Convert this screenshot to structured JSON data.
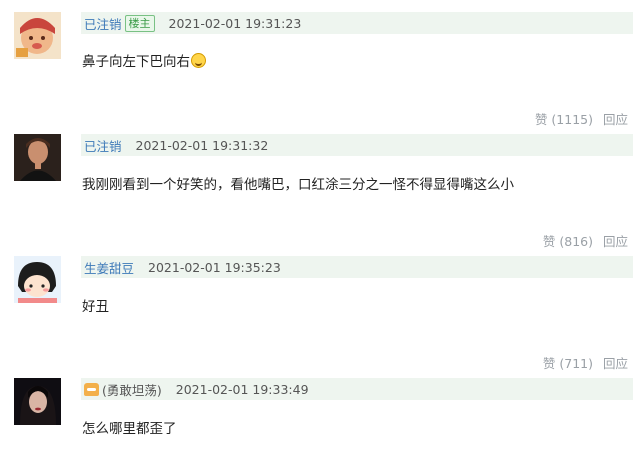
{
  "comments": [
    {
      "user": "已注销",
      "badge": "楼主",
      "time": "2021-02-01 19:31:23",
      "text": "鼻子向左下巴向右",
      "emoji_icon": "grin-emoji-icon",
      "like_label": "赞 (1115)",
      "reply_label": "回应"
    },
    {
      "user": "已注销",
      "time": "2021-02-01 19:31:32",
      "text": "我刚刚看到一个好笑的，看他嘴巴，口红涂三分之一怪不得显得嘴这么小",
      "like_label": "赞 (816)",
      "reply_label": "回应"
    },
    {
      "user": "生姜甜豆",
      "time": "2021-02-01 19:35:23",
      "text": "好丑",
      "like_label": "赞 (711)",
      "reply_label": "回应"
    },
    {
      "user": "(勇敢坦荡)",
      "time": "2021-02-01 19:33:49",
      "text": "怎么哪里都歪了"
    }
  ]
}
